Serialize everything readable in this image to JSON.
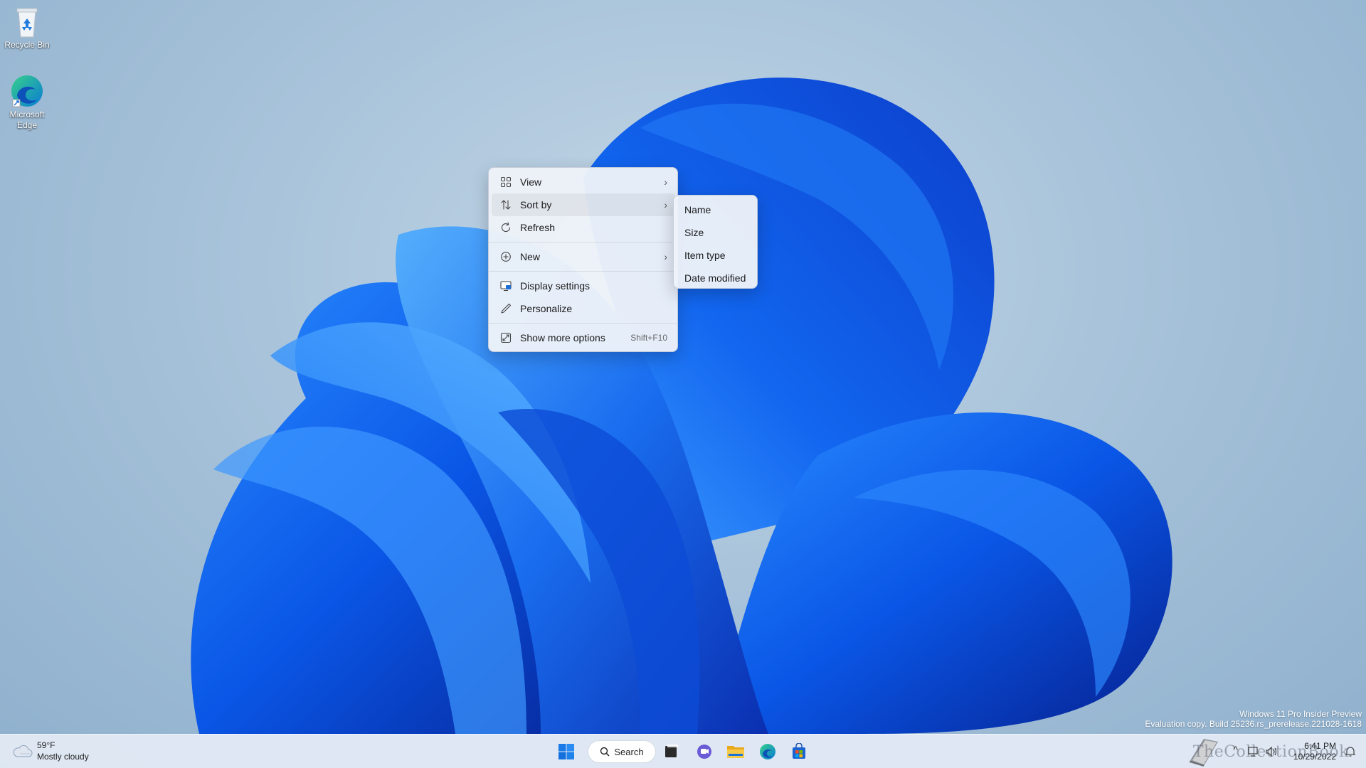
{
  "desktop_icons": [
    {
      "label": "Recycle Bin",
      "icon": "recycle-bin-icon"
    },
    {
      "label": "Microsoft Edge",
      "icon": "edge-icon"
    }
  ],
  "context_menu": {
    "items": [
      {
        "label": "View",
        "icon": "grid-view-icon",
        "has_submenu": true
      },
      {
        "label": "Sort by",
        "icon": "sort-arrows-icon",
        "has_submenu": true,
        "active": true
      },
      {
        "label": "Refresh",
        "icon": "refresh-icon"
      },
      {
        "label": "New",
        "icon": "plus-circle-icon",
        "has_submenu": true
      },
      {
        "label": "Display settings",
        "icon": "display-icon"
      },
      {
        "label": "Personalize",
        "icon": "pen-icon"
      },
      {
        "label": "Show more options",
        "icon": "expand-icon",
        "accelerator": "Shift+F10"
      }
    ],
    "chevron": "›"
  },
  "sort_submenu": {
    "items": [
      "Name",
      "Size",
      "Item type",
      "Date modified"
    ]
  },
  "watermark": {
    "line1": "Windows 11 Pro Insider Preview",
    "line2": "Evaluation copy. Build 25236.rs_prerelease.221028-1618"
  },
  "taskbar": {
    "weather": {
      "temp": "59°F",
      "condition": "Mostly cloudy",
      "icon": "cloud-icon"
    },
    "search_label": "Search",
    "pinned": [
      "start-icon",
      "task-view-icon",
      "chat-icon",
      "file-explorer-icon",
      "edge-icon",
      "store-icon"
    ],
    "clock": {
      "time": "6:41 PM",
      "date": "10/29/2022"
    },
    "overlay_brand": "TheCollectionBook"
  },
  "colors": {
    "accent": "#0067c0",
    "menu_bg": "#eef2f9"
  }
}
